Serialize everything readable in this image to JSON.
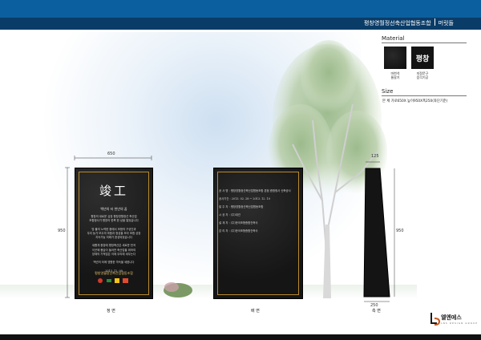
{
  "header": {
    "org_name": "평창영월정선축산업협동조합",
    "doc_type": "머릿돌"
  },
  "material": {
    "title": "Material",
    "swatches": [
      {
        "label": "마천석",
        "sublabel": "물갈기",
        "icon": "granite-swatch"
      },
      {
        "label": "지정문구",
        "sublabel": "음각기공",
        "text": "평창",
        "icon": "engraved-text-swatch"
      }
    ]
  },
  "size": {
    "title": "Size",
    "text": "본   체  가로650X 높이950X폭250(좌단기준)"
  },
  "front": {
    "label": "정 면",
    "title": "竣工",
    "subtitle": "백년의 터 천년의 꿈",
    "body": [
      "평창의 새로운 심장 평창영월정선 축산업",
      "조합청사가 평창의 한복 한 상을 열었습니다",
      "",
      "땅 풀의 노력한 중에서 조합의 구성인과",
      "우리 농가 모두의 마음과 정성을 모아 조합 성장",
      "지속가능 미래가 완성되었습니다",
      "",
      "새롭게 중장에 평창축산은 새로운 탄곡",
      "이곳에 풍습이 들어찬 축산업을 위하여",
      "장채의 기적업은 이제 우리에 새우는다",
      "",
      "백년의 터에 영원한 약속을 세웁니다",
      "",
      "2013. 12. 09"
    ],
    "org": "평창영월정선축산업협동조합",
    "width_dim": "650",
    "height_dim": "950"
  },
  "back": {
    "label": "배 면",
    "rows": [
      {
        "key": "공 사 명",
        "value": ": 평창영월정선축산업협동조합 본점 종합청사 신축공사"
      },
      {
        "key": "공사기간",
        "value": ": 2013. 02. 28 ~ 2013. 12. 10"
      },
      {
        "key": "발 주 자",
        "value": ": 평창영월정선축산업협동조합"
      },
      {
        "key": "시 공 자",
        "value": ": (주)대건"
      },
      {
        "key": "설 계 자",
        "value": ": (주)한국조형종합건축사"
      },
      {
        "key": "감 리 자",
        "value": ": (주)한국조형종합건축사"
      }
    ]
  },
  "side": {
    "label": "측 면",
    "top_dim": "125",
    "bottom_dim": "250",
    "height_dim": "950"
  },
  "company": {
    "name": "엘엔에스",
    "sub": "LNS DESIGN GROUP"
  }
}
